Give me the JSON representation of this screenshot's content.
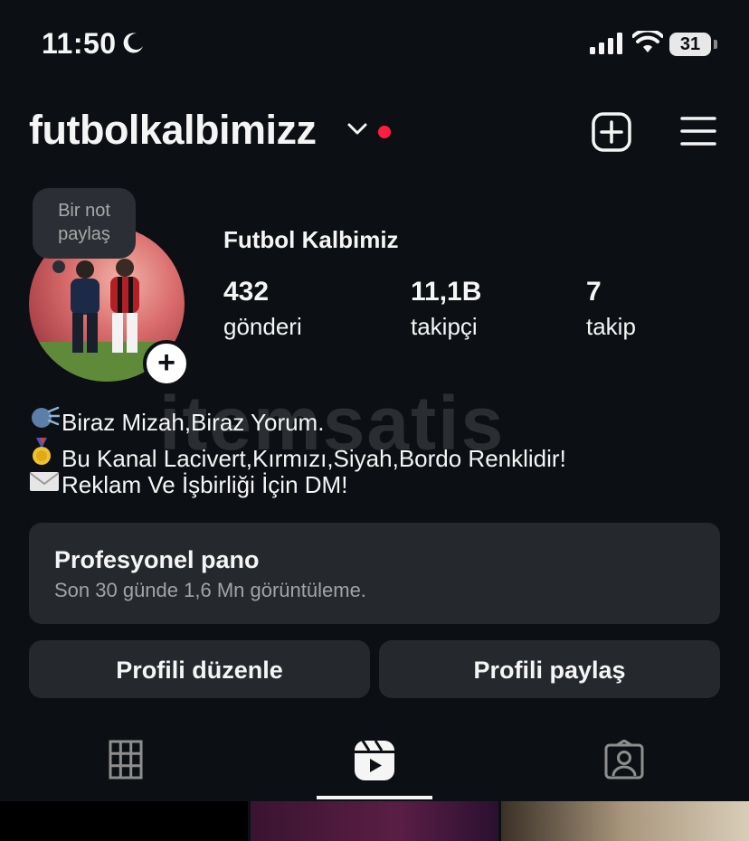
{
  "status_bar": {
    "time": "11:50",
    "battery": "31"
  },
  "header": {
    "username": "futbolkalbimizz"
  },
  "note": {
    "line1": "Bir not",
    "line2": "paylaş"
  },
  "profile": {
    "display_name": "Futbol Kalbimiz",
    "stats": [
      {
        "value": "432",
        "label": "gönderi"
      },
      {
        "value": "11,1B",
        "label": "takipçi"
      },
      {
        "value": "7",
        "label": "takip"
      }
    ],
    "bio": [
      {
        "icon": "speaking-head-icon",
        "text": "Biraz Mizah,Biraz Yorum."
      },
      {
        "icon": "medal-icon",
        "text": "Bu Kanal Lacivert,Kırmızı,Siyah,Bordo Renklidir!"
      },
      {
        "icon": "envelope-icon",
        "text": "Reklam Ve İşbirliği İçin DM!"
      }
    ]
  },
  "watermark": "itemsatis",
  "professional_dashboard": {
    "title": "Profesyonel pano",
    "subtitle": "Son 30 günde 1,6 Mn görüntüleme."
  },
  "buttons": {
    "edit_profile": "Profili düzenle",
    "share_profile": "Profili paylaş"
  },
  "tabs": [
    {
      "icon": "grid-icon",
      "active": false
    },
    {
      "icon": "reels-icon",
      "active": true
    },
    {
      "icon": "tagged-icon",
      "active": false
    }
  ],
  "colors": {
    "background": "#0c1014",
    "panel": "#25292e",
    "notification": "#ff1e40"
  }
}
